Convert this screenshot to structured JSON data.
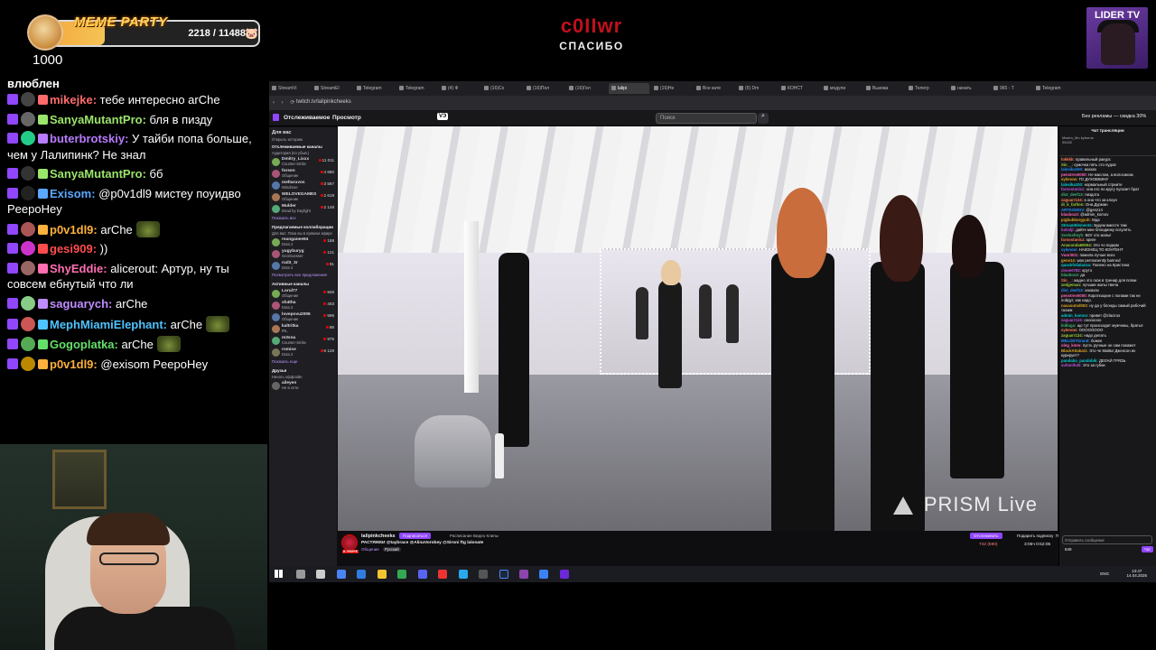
{
  "meme_widget": {
    "title": "MEME PARTY",
    "progress_text": "2218 / 11488",
    "progress_fraction": 0.193,
    "amount": "1000"
  },
  "alert": {
    "name": "c0IIwr",
    "message": "СПАСИБО"
  },
  "logo": {
    "text": "LIDER TV"
  },
  "stream_chat": {
    "cut_line": "влюблен",
    "messages": [
      {
        "user": "mikejke:",
        "text": "тебе интересно arChe",
        "color": "#ff6b6b",
        "emote": false
      },
      {
        "user": "SanyaMutantPro:",
        "text": "бля в пизду",
        "color": "#9be56b",
        "emote": false
      },
      {
        "user": "buterbrotskiy:",
        "text": "У тайби попа больше, чем у Лалипинк? Не знал",
        "color": "#b97bff",
        "emote": false
      },
      {
        "user": "SanyaMutantPro:",
        "text": "бб",
        "color": "#9be56b",
        "emote": false
      },
      {
        "user": "Exisom:",
        "text": "@p0v1dl9 мистеу поуидво PeepoHey",
        "color": "#5aa8ff",
        "emote": false
      },
      {
        "user": "p0v1dl9:",
        "text": "arChe",
        "color": "#ffb13d",
        "emote": true
      },
      {
        "user": "gesi909:",
        "text": "))",
        "color": "#ff4d4d",
        "emote": false
      },
      {
        "user": "ShyEddie:",
        "text": "alicerout: Артур, ну ты совсем ебнутый что ли",
        "color": "#ff6fb2",
        "emote": false
      },
      {
        "user": "saguarych:",
        "text": "arChe",
        "color": "#c08cff",
        "emote": false
      },
      {
        "user": "MephMiamiElephant:",
        "text": "arChe",
        "color": "#4fc3ff",
        "emote": true
      },
      {
        "user": "Gogoplatka:",
        "text": "arChe",
        "color": "#64e06a",
        "emote": true
      },
      {
        "user": "p0v1dl9:",
        "text": "@exisom PeepoHey",
        "color": "#ffb13d",
        "emote": false
      }
    ]
  },
  "browser": {
    "tabs": [
      "StreamVi",
      "StreamEl",
      "Telegram",
      "Telegram",
      "(4) Ф",
      "(16)Co",
      "(16)Пол",
      "(16)Гел",
      "lalipi",
      "(16)Не",
      "Все кате",
      "(5) Dm",
      "КОНСТ",
      "модули",
      "Вызова",
      "Телегр",
      "начать",
      "965 - Т",
      "Telegram"
    ],
    "url": "twitch.tv/lalipinkcheeks",
    "nav_following": "Отслеживаемое",
    "nav_browse": "Просмотр",
    "vpn_label": "VЭ",
    "search_placeholder": "Поиск",
    "ads_text": "Без рекламы — скидка 30%"
  },
  "sidebar": {
    "for_you": "Для вас",
    "history": "Открыть историю",
    "followed_title": "Отслеживаемые каналы",
    "followed_sub": "Аудитория (по убыв.)",
    "followed": [
      {
        "name": "Dmitry_Lixxx",
        "game": "Counter-Strike",
        "viewers": "11 011"
      },
      {
        "name": "forsen",
        "game": "Общение",
        "viewers": "4 680"
      },
      {
        "name": "meltaruvos",
        "game": "Windrose",
        "viewers": "3 587"
      },
      {
        "name": "WELOVEGAMES",
        "game": "Общение",
        "viewers": "2 619"
      },
      {
        "name": "Mulder",
        "game": "Dead by Daylight",
        "viewers": "2 148"
      }
    ],
    "show_more_1": "Показать все",
    "collab_title": "Предлагаемые коллаборации",
    "collab_sub": "Для вас: Пока вы в прямом эфире",
    "collab": [
      {
        "name": "reanganee94",
        "game": "Dota 2",
        "viewers": "188"
      },
      {
        "name": "yugyburyg",
        "game": "GeoGuesser",
        "viewers": "121"
      },
      {
        "name": "rud3_3r",
        "game": "Dota 2",
        "viewers": "91"
      }
    ],
    "collab_more": "Посмотреть все предложения",
    "active_title": "Активные каналы",
    "active": [
      {
        "name": "Lorul77",
        "game": "Общение",
        "viewers": "946"
      },
      {
        "name": "sh4tha",
        "game": "Dota 2",
        "viewers": "403"
      },
      {
        "name": "lovepovu2006",
        "game": "Общение",
        "viewers": "596"
      },
      {
        "name": "kaltritka",
        "game": "IRL",
        "viewers": "88"
      },
      {
        "name": "m3sna",
        "game": "Counter-Strike",
        "viewers": "975"
      },
      {
        "name": "romise",
        "game": "Dota 2",
        "viewers": "6 128"
      }
    ],
    "show_more_2": "Показать еще",
    "friends_title": "Друзья",
    "friends_sub": "Начать оффлайн",
    "friend": {
      "name": "aileyen",
      "game": "Не в сети"
    }
  },
  "video": {
    "watermark": "PRISM Live"
  },
  "channel": {
    "name": "lalipinkcheeks",
    "live": "В ЭФИРЕ",
    "follow": "Подписаться",
    "links": "Расписание  Видео  Клипы",
    "title": "РАСТЯЖКИ @taybrace @AlinaVorobey @Sironi ftg lalonate",
    "category": "Общение",
    "tag": "Русский",
    "subscribe_follow": "Отслеживать",
    "subscribe": "Подарить подписку",
    "subscribe2": "Подписаться",
    "viewers": "742 (590)",
    "uptime": "3:05ч 0:52:05"
  },
  "twitch_chat": {
    "header": "Чат трансляции",
    "pinned_user": "Maxim_Mo",
    "pinned_a": "kyburus",
    "pinned_b": "95432",
    "lines": [
      {
        "user": "lokkkk:",
        "text": "правильный ракурс"
      },
      {
        "user": "Sin__:",
        "text": "сумочка пять сто пудов"
      },
      {
        "user": "lalosika100:",
        "text": "ахахах"
      },
      {
        "user": "penstrev0000:",
        "text": "Не маслом, а волосиком."
      },
      {
        "user": "sylenow:",
        "text": "ГО ДУХОВКИНУ"
      },
      {
        "user": "lalosika100:",
        "text": "нормальный стриите"
      },
      {
        "user": "farnostanicz:",
        "text": "она его по кругу пускает брат"
      },
      {
        "user": "dist_deef13:",
        "text": "пиздота"
      },
      {
        "user": "zaguarr124:",
        "text": "а она что за клоун"
      },
      {
        "user": "di_k_farlton:",
        "text": "Она Дурман"
      },
      {
        "user": "ARTKOMOV:",
        "text": "@genz14"
      },
      {
        "user": "blaxbox3:",
        "text": "@admin_komov"
      },
      {
        "user": "pigbubborgyuh:",
        "text": "Мда"
      },
      {
        "user": "StreamElements:",
        "text": "Будем вместе там"
      },
      {
        "user": "balsdji:",
        "text": "дайте мне блондинку погулять"
      },
      {
        "user": "Svelosfmyh:",
        "text": "ВОт это жопы!"
      },
      {
        "user": "farnostanicz:",
        "text": "криге"
      },
      {
        "user": "Anaconda69064:",
        "text": "Это чо подкум"
      },
      {
        "user": "sylenow:",
        "text": "НАКОНЕЦ ТО КОНТЕНТ"
      },
      {
        "user": "Vuori001:",
        "text": "пажила лучше всех"
      },
      {
        "user": "gene14:",
        "text": "was permanently banned"
      },
      {
        "user": "quackfolialanza:",
        "text": "Полено на Кристина"
      },
      {
        "user": "clooe0782:",
        "text": "круто"
      },
      {
        "user": "blaxbox3:",
        "text": "да"
      },
      {
        "user": "Sin__:",
        "text": "жадно это скок в тренир для попки"
      },
      {
        "user": "zedgeman:",
        "text": "лучшие жопы твича"
      },
      {
        "user": "dist_deef13:",
        "text": "хахахах"
      },
      {
        "user": "penstrev0000:",
        "text": "Короткоцкие с попами так не пойдут, как надо."
      },
      {
        "user": "naxaoutsd003:",
        "text": "ну да у блонды самый рабочий таззик"
      },
      {
        "user": "admin_komov:",
        "text": "привет @zlacirus"
      },
      {
        "user": "zaguarr124:",
        "text": "оооооооо"
      },
      {
        "user": "kidluga:",
        "text": "що тут происходит мужчины, братья"
      },
      {
        "user": "sylenow:",
        "text": "ОООООООО"
      },
      {
        "user": "zaguarr124:",
        "text": "надо делать"
      },
      {
        "user": "MELODYbrand:",
        "text": "божее"
      },
      {
        "user": "oleg_kmm:",
        "text": "пусть ручные он сам покажет"
      },
      {
        "user": "BlackAttakat1:",
        "text": "Это че Майкл Джексон их курирует?"
      },
      {
        "user": "pandabo_pandobik:",
        "text": "ДЕЛАЙ ГРЯЗЬ"
      },
      {
        "user": "sultanlh40:",
        "text": "Это за губки"
      }
    ],
    "input_placeholder": "Отправить сообщение",
    "points": "849",
    "chat_button": "Чат"
  },
  "taskbar": {
    "lang": "ENG",
    "time": "13:47",
    "date": "14.04.2026"
  }
}
